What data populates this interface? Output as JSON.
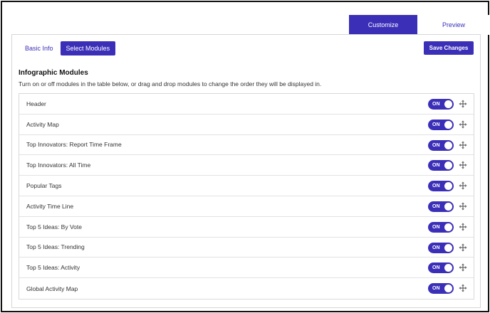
{
  "top_tabs": {
    "customize": "Customize",
    "preview": "Preview"
  },
  "sub_tabs": {
    "basic_info": "Basic Info",
    "select_modules": "Select Modules"
  },
  "save_button": "Save Changes",
  "section": {
    "title": "Infographic Modules",
    "description": "Turn on or off modules in the table below, or drag and drop modules to change the order they will be displayed in."
  },
  "toggle_label": "ON",
  "icons": {
    "drag": "drag-move-icon"
  },
  "colors": {
    "accent": "#3b2fb8"
  },
  "modules": [
    {
      "label": "Header",
      "state": "ON"
    },
    {
      "label": "Activity Map",
      "state": "ON"
    },
    {
      "label": "Top Innovators: Report Time Frame",
      "state": "ON"
    },
    {
      "label": "Top Innovators: All Time",
      "state": "ON"
    },
    {
      "label": "Popular Tags",
      "state": "ON"
    },
    {
      "label": "Activity Time Line",
      "state": "ON"
    },
    {
      "label": "Top 5 Ideas: By Vote",
      "state": "ON"
    },
    {
      "label": "Top 5 Ideas: Trending",
      "state": "ON"
    },
    {
      "label": "Top 5 Ideas: Activity",
      "state": "ON"
    },
    {
      "label": "Global Activity Map",
      "state": "ON"
    }
  ]
}
